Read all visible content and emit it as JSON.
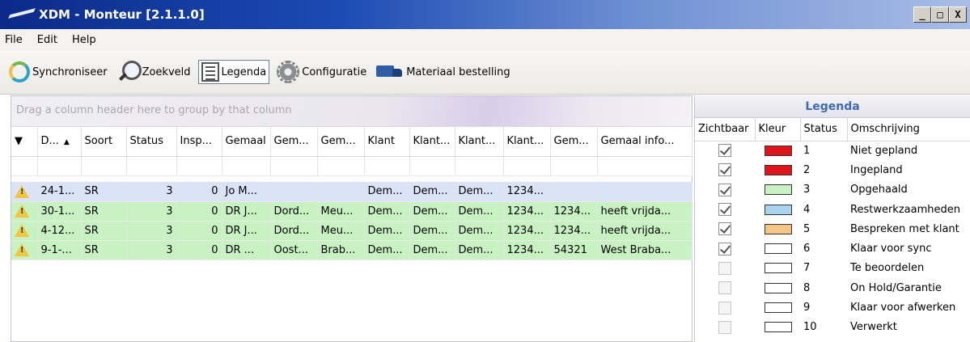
{
  "window": {
    "title": "XDM - Monteur [2.1.1.0]",
    "controls": [
      "_",
      "□",
      "X"
    ]
  },
  "menu": [
    {
      "label": "File"
    },
    {
      "label": "Edit"
    },
    {
      "label": "Help"
    }
  ],
  "toolbar": {
    "synchronize": "Synchroniseer",
    "search": "Zoekveld",
    "legend": "Legenda",
    "config": "Configuratie",
    "order": "Materiaal bestelling"
  },
  "grid": {
    "group_hint": "Drag a column header here to group by that column",
    "columns": [
      "",
      "D...",
      "Soort",
      "Status",
      "Insp...",
      "Gemaal",
      "Gem...",
      "Gem...",
      "Klant",
      "Klant...",
      "Klant...",
      "Klant...",
      "Gem...",
      "Gemaal info..."
    ],
    "rows": [
      {
        "style": "selected",
        "cells": [
          "24-1...",
          "SR",
          "3",
          "0",
          "Jo M...",
          "",
          "",
          "Dem...",
          "Dem...",
          "Dem...",
          "1234...",
          "",
          ""
        ]
      },
      {
        "style": "green",
        "cells": [
          "30-1...",
          "SR",
          "3",
          "0",
          "DR J...",
          "Dord...",
          "Meu...",
          "Dem...",
          "Dem...",
          "Dem...",
          "1234...",
          "1234...",
          "heeft vrijda..."
        ]
      },
      {
        "style": "green",
        "cells": [
          "4-12...",
          "SR",
          "3",
          "0",
          "DR J...",
          "Dord...",
          "Meu...",
          "Dem...",
          "Dem...",
          "Dem...",
          "1234...",
          "1234...",
          "heeft vrijda..."
        ]
      },
      {
        "style": "green",
        "cells": [
          "9-1-...",
          "SR",
          "3",
          "0",
          "DR ...",
          "Oost...",
          "Brab...",
          "Dem...",
          "Dem...",
          "Dem...",
          "1234...",
          "54321",
          "West Braba..."
        ]
      }
    ]
  },
  "legend": {
    "title": "Legenda",
    "headers": [
      "Zichtbaar",
      "Kleur",
      "Status",
      "Omschrijving"
    ],
    "items": [
      {
        "visible": true,
        "color": "#e0141b",
        "status": "1",
        "description": "Niet gepland"
      },
      {
        "visible": true,
        "color": "#e0141b",
        "status": "2",
        "description": "Ingepland"
      },
      {
        "visible": true,
        "color": "#c8f2c2",
        "status": "3",
        "description": "Opgehaald"
      },
      {
        "visible": true,
        "color": "#a9d3ee",
        "status": "4",
        "description": "Restwerkzaamheden"
      },
      {
        "visible": true,
        "color": "#f4c585",
        "status": "5",
        "description": "Bespreken met klant"
      },
      {
        "visible": true,
        "color": "#ffffff",
        "status": "6",
        "description": "Klaar voor sync"
      },
      {
        "visible": false,
        "color": "#ffffff",
        "status": "7",
        "description": "Te beoordelen"
      },
      {
        "visible": false,
        "color": "#ffffff",
        "status": "8",
        "description": "On Hold/Garantie"
      },
      {
        "visible": false,
        "color": "#ffffff",
        "status": "9",
        "description": "Klaar voor afwerken"
      },
      {
        "visible": false,
        "color": "#ffffff",
        "status": "10",
        "description": "Verwerkt"
      }
    ]
  }
}
